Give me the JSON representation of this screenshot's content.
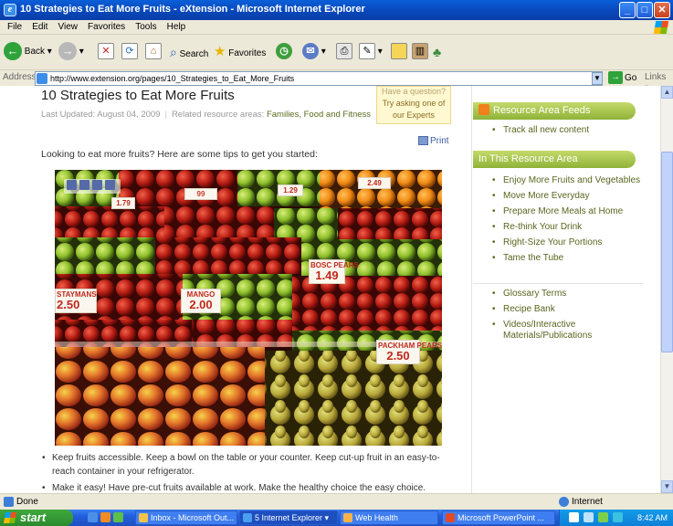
{
  "window": {
    "title": "10 Strategies to Eat More Fruits - eXtension - Microsoft Internet Explorer"
  },
  "menu": [
    "File",
    "Edit",
    "View",
    "Favorites",
    "Tools",
    "Help"
  ],
  "toolbar": {
    "back_label": "Back",
    "search_label": "Search",
    "favorites_label": "Favorites"
  },
  "address": {
    "label": "Address",
    "url": "http://www.extension.org/pages/10_Strategies_to_Eat_More_Fruits",
    "go_label": "Go",
    "links_label": "Links"
  },
  "page": {
    "title": "10 Strategies to Eat More Fruits",
    "last_updated": "Last Updated: August 04, 2009",
    "related_label": "Related resource areas:",
    "related_link": "Families, Food and Fitness",
    "question_line1": "Have a question?",
    "question_line2": "Try asking one of",
    "question_line3": "our Experts",
    "print_label": "Print",
    "intro": "Looking to eat more fruits? Here are some tips to get you started:",
    "photo_signs": {
      "mango": "MANGO",
      "mango_price": "2.00",
      "pears": "BOSC PEARS",
      "pears_price": "1.49",
      "packham": "PACKHAM PEARS",
      "packham_price": "2.50",
      "left_sign": "STAYMANS",
      "left_price": "2.50"
    },
    "bullets": [
      "Keep fruits accessible. Keep a bowl on the table or your counter. Keep cut-up fruit in an easy-to-reach container in your refrigerator.",
      "Make it easy! Have pre-cut fruits available at work. Make the healthy choice the easy choice."
    ]
  },
  "sidebar": {
    "feeds_title": "Resource Area Feeds",
    "feeds_items": [
      "Track all new content"
    ],
    "area_title": "In This Resource Area",
    "area_items": [
      "Enjoy More Fruits and Vegetables",
      "Move More Everyday",
      "Prepare More Meals at Home",
      "Re-think Your Drink",
      "Right-Size Your Portions",
      "Tame the Tube"
    ],
    "extra_items": [
      "Glossary Terms",
      "Recipe Bank",
      "Videos/Interactive Materials/Publications"
    ]
  },
  "status": {
    "left": "Done",
    "zone": "Internet"
  },
  "taskbar": {
    "start": "start",
    "tasks": [
      "Inbox - Microsoft Out...",
      "5 Internet Explorer",
      "Web Health",
      "Microsoft PowerPoint ..."
    ],
    "clock": "8:42 AM"
  },
  "colors": {
    "titlebar": "#0846b8",
    "sidebar_head": "#8fb238",
    "link": "#58661e",
    "taskbar": "#245edb",
    "start": "#2c8a2c"
  }
}
